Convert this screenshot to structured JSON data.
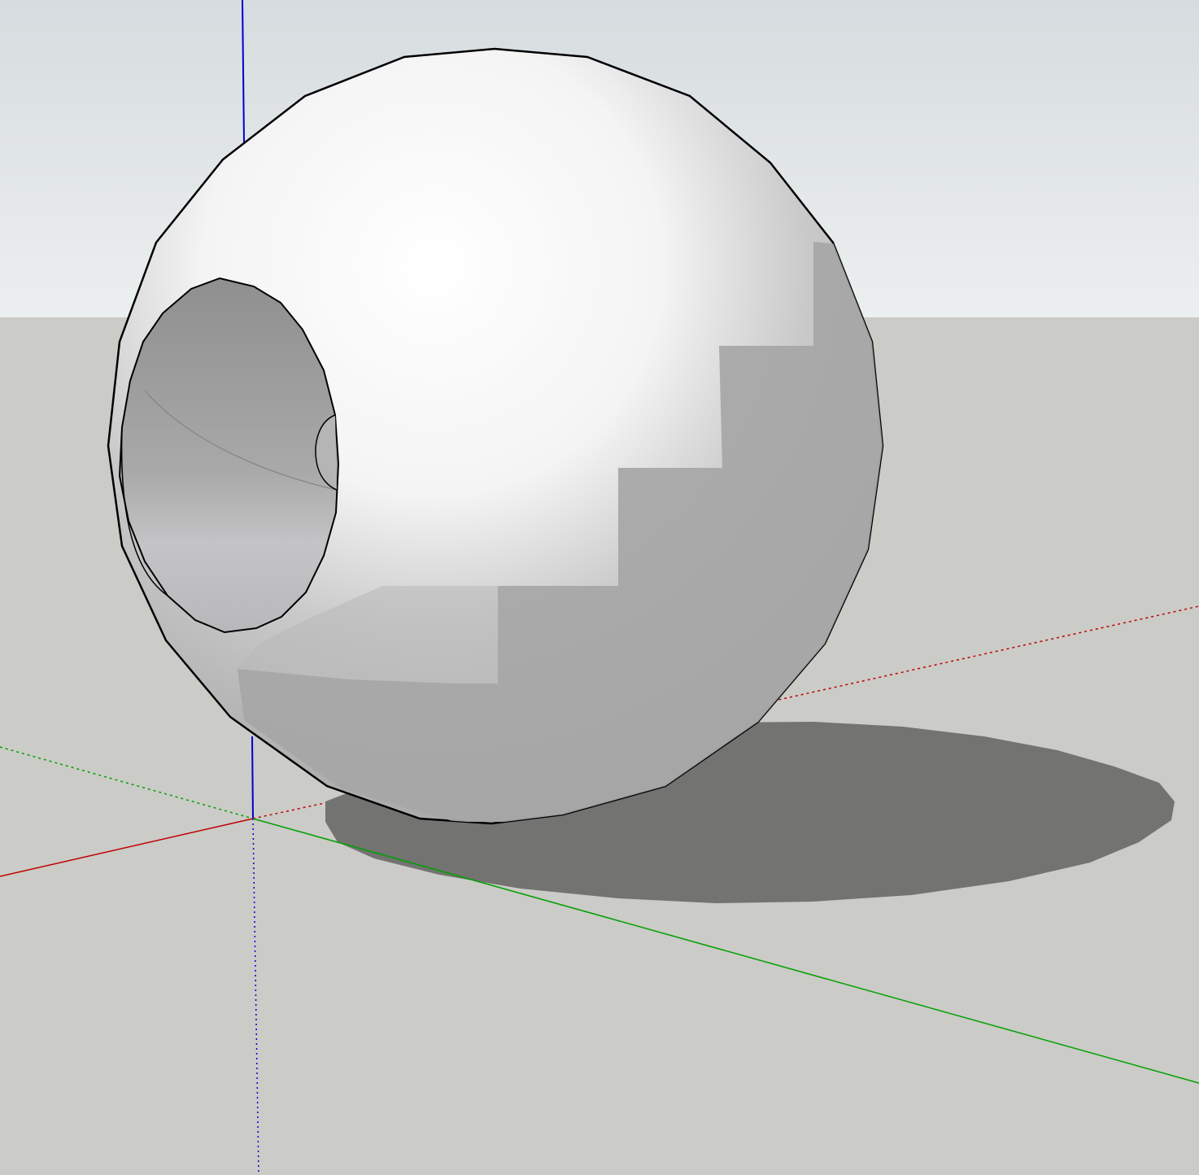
{
  "app": {
    "type": "3d-modeling-viewport",
    "view": "perspective"
  },
  "colors": {
    "sky_top": "#d6dcdf",
    "sky_bottom": "#ecefef",
    "ground": "#cbcbc7",
    "shadow": "#737371",
    "sphere_light": "#ffffff",
    "sphere_shade": "#a6a6a6",
    "hole_inner": "#9a9a9a",
    "edge": "#000000",
    "axis_red": "#c00000",
    "axis_green": "#00a000",
    "axis_blue": "#0000d0"
  },
  "scene": {
    "model": {
      "name": "sphere-with-hole",
      "features": [
        "faceted-sphere",
        "cylindrical-hole",
        "cast-shadow"
      ]
    },
    "axes": [
      {
        "name": "red-axis",
        "color": "#c00000",
        "style": "solid-and-dotted"
      },
      {
        "name": "green-axis",
        "color": "#00a000",
        "style": "solid-and-dotted"
      },
      {
        "name": "blue-axis",
        "color": "#0000d0",
        "style": "solid-and-dotted"
      }
    ]
  }
}
